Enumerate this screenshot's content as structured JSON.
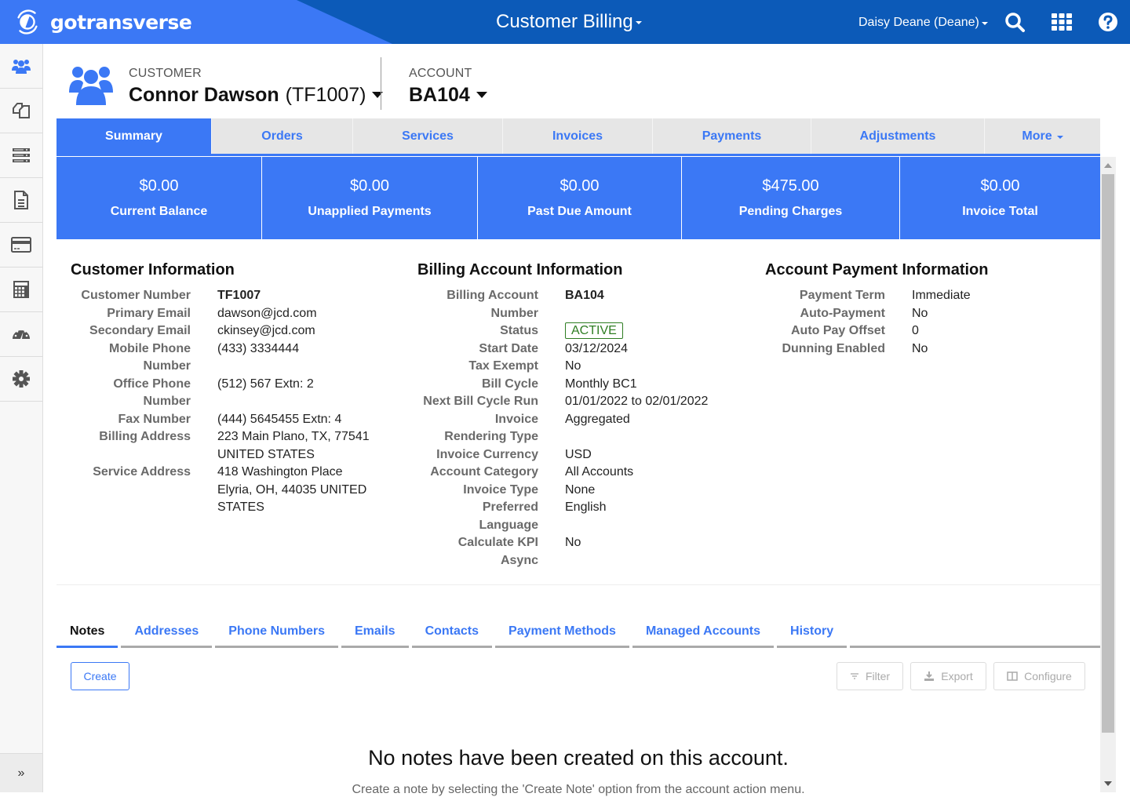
{
  "header": {
    "brand": "gotransverse",
    "app_title": "Customer Billing",
    "user": "Daisy Deane (Deane)",
    "icons": [
      "search-icon",
      "apps-grid-icon",
      "help-icon"
    ]
  },
  "leftnav": {
    "items": [
      {
        "name": "customers",
        "icon": "users-icon"
      },
      {
        "name": "orders",
        "icon": "copy-documents-icon"
      },
      {
        "name": "services",
        "icon": "server-list-icon"
      },
      {
        "name": "invoices",
        "icon": "document-icon"
      },
      {
        "name": "payments",
        "icon": "credit-card-icon"
      },
      {
        "name": "billing",
        "icon": "calculator-icon"
      },
      {
        "name": "dashboard",
        "icon": "gauge-icon"
      },
      {
        "name": "settings",
        "icon": "gear-icon"
      }
    ],
    "expand_label": "»"
  },
  "customer": {
    "label": "CUSTOMER",
    "name": "Connor Dawson",
    "id": "(TF1007)"
  },
  "account": {
    "label": "ACCOUNT",
    "id": "BA104"
  },
  "tabs": [
    {
      "label": "Summary",
      "active": true
    },
    {
      "label": "Orders"
    },
    {
      "label": "Services"
    },
    {
      "label": "Invoices"
    },
    {
      "label": "Payments"
    },
    {
      "label": "Adjustments"
    },
    {
      "label": "More"
    }
  ],
  "tiles": [
    {
      "amount": "$0.00",
      "label": "Current Balance"
    },
    {
      "amount": "$0.00",
      "label": "Unapplied Payments"
    },
    {
      "amount": "$0.00",
      "label": "Past Due Amount"
    },
    {
      "amount": "$475.00",
      "label": "Pending Charges"
    },
    {
      "amount": "$0.00",
      "label": "Invoice Total"
    }
  ],
  "customer_info": {
    "title": "Customer Information",
    "rows": [
      {
        "label": "Customer Number",
        "value": "TF1007"
      },
      {
        "label": "Primary Email",
        "value": "dawson@jcd.com"
      },
      {
        "label": "Secondary Email",
        "value": "ckinsey@jcd.com"
      },
      {
        "label": "Mobile Phone Number",
        "value": "(433) 3334444"
      },
      {
        "label": "Office Phone Number",
        "value": "(512) 567 Extn: 2"
      },
      {
        "label": "Fax Number",
        "value": "(444) 5645455 Extn: 4"
      },
      {
        "label": "Billing Address",
        "value": "223 Main Plano, TX, 77541 UNITED STATES"
      },
      {
        "label": "Service Address",
        "value": "418 Washington Place Elyria, OH, 44035 UNITED STATES"
      }
    ]
  },
  "billing_info": {
    "title": "Billing Account Information",
    "rows": [
      {
        "label": "Billing Account Number",
        "value": "BA104"
      },
      {
        "label": "Status",
        "value": "ACTIVE"
      },
      {
        "label": "Start Date",
        "value": "03/12/2024"
      },
      {
        "label": "Tax Exempt",
        "value": "No"
      },
      {
        "label": "Bill Cycle",
        "value": "Monthly BC1"
      },
      {
        "label": "Next Bill Cycle Run",
        "value": "01/01/2022 to 02/01/2022"
      },
      {
        "label": "Invoice Rendering Type",
        "value": "Aggregated"
      },
      {
        "label": "Invoice Currency",
        "value": "USD"
      },
      {
        "label": "Account Category",
        "value": "All Accounts"
      },
      {
        "label": "Invoice Type",
        "value": "None"
      },
      {
        "label": "Preferred Language",
        "value": "English"
      },
      {
        "label": "Calculate KPI Async",
        "value": "No"
      }
    ],
    "status_color": "#2e7d22"
  },
  "payment_info": {
    "title": "Account Payment Information",
    "rows": [
      {
        "label": "Payment Term",
        "value": "Immediate"
      },
      {
        "label": "Auto-Payment",
        "value": "No"
      },
      {
        "label": "Auto Pay Offset",
        "value": "0"
      },
      {
        "label": "Dunning Enabled",
        "value": "No"
      }
    ]
  },
  "subtabs": [
    {
      "label": "Notes",
      "active": true
    },
    {
      "label": "Addresses"
    },
    {
      "label": "Phone Numbers"
    },
    {
      "label": "Emails"
    },
    {
      "label": "Contacts"
    },
    {
      "label": "Payment Methods"
    },
    {
      "label": "Managed Accounts"
    },
    {
      "label": "History"
    }
  ],
  "actions": {
    "create": "Create",
    "filter": "Filter",
    "export": "Export",
    "configure": "Configure"
  },
  "empty_state": {
    "title": "No notes have been created on this account.",
    "subtitle": "Create a note by selecting the 'Create Note' option from the account action menu."
  },
  "colors": {
    "primary": "#3b78f5",
    "header_dark": "#0c5ab8",
    "active_badge": "#2e7d22"
  }
}
